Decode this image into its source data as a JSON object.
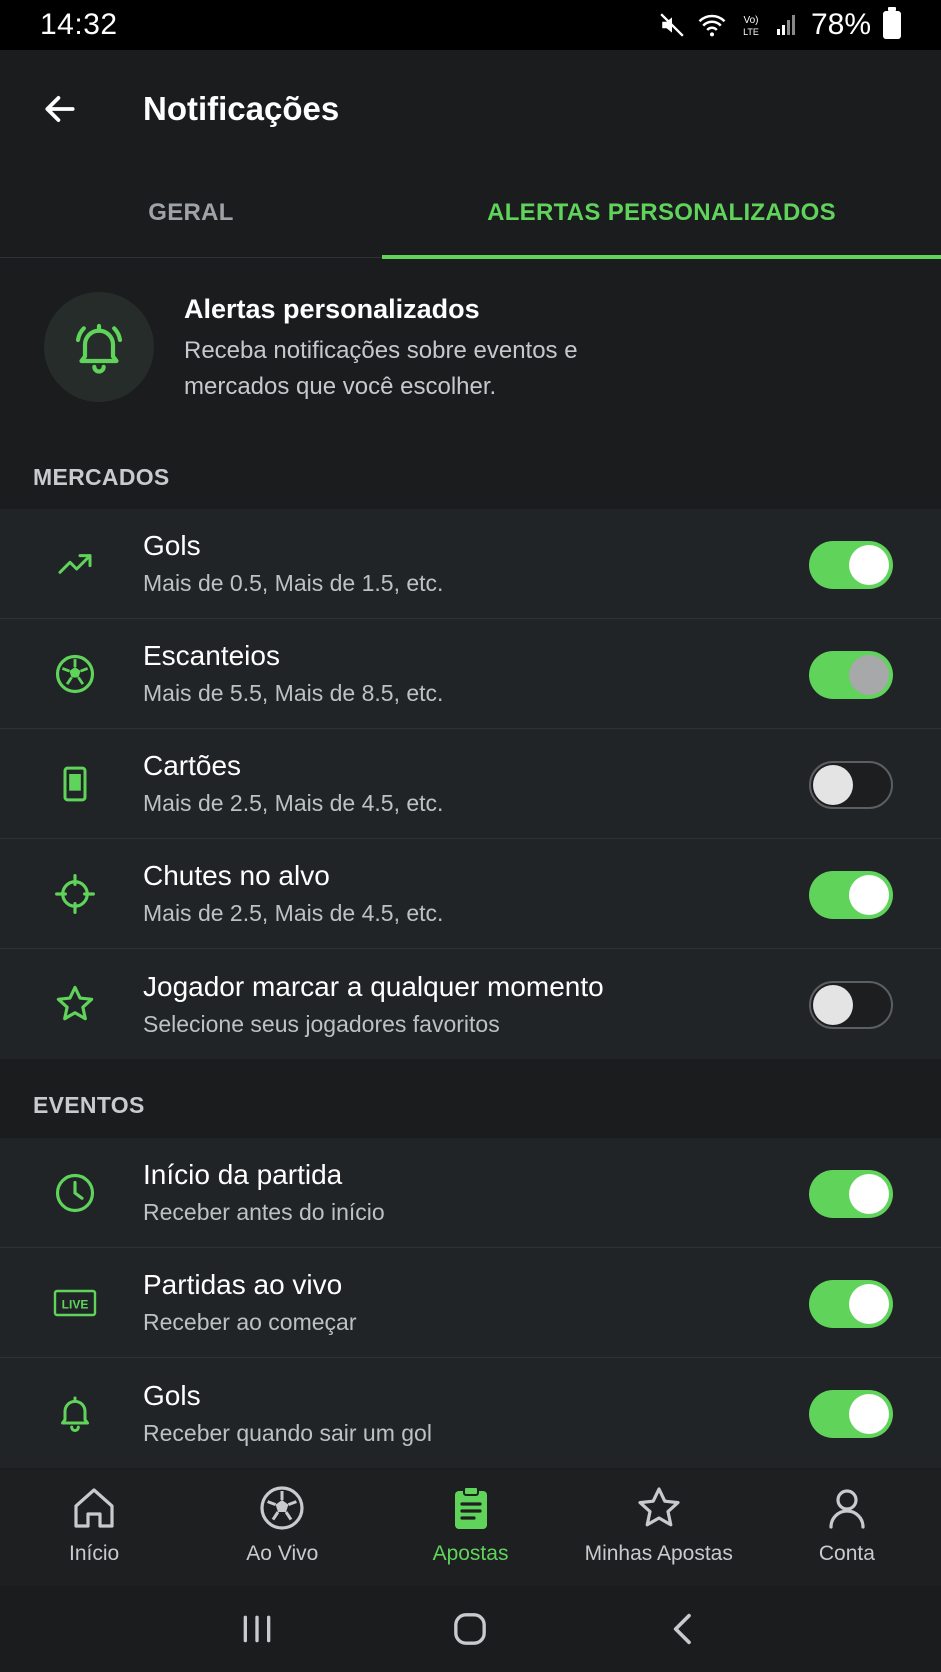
{
  "status_bar": {
    "time": "14:32",
    "battery": "78%"
  },
  "header": {
    "title": "Notificações",
    "back_icon": "arrow-left-icon"
  },
  "tabs": [
    {
      "label": "GERAL",
      "active": false
    },
    {
      "label": "ALERTAS PERSONALIZADOS",
      "active": true
    }
  ],
  "intro": {
    "icon": "bell-ringing-icon",
    "title": "Alertas personalizados",
    "description": "Receba notificações sobre eventos e mercados que você escolher."
  },
  "mercados": {
    "section_title": "MERCADOS",
    "items": [
      {
        "icon": "trend-up-icon",
        "title": "Gols",
        "subtitle": "Mais de 0.5, Mais de 1.5, etc.",
        "enabled": true
      },
      {
        "icon": "soccer-ball-icon",
        "title": "Escanteios",
        "subtitle": "Mais de 5.5, Mais de 8.5, etc.",
        "enabled": true
      },
      {
        "icon": "card-icon",
        "title": "Cartões",
        "subtitle": "Mais de 2.5, Mais de 4.5, etc.",
        "enabled": false
      },
      {
        "icon": "crosshair-icon",
        "title": "Chutes no alvo",
        "subtitle": "Mais de 2.5, Mais de 4.5, etc.",
        "enabled": true
      },
      {
        "icon": "star-icon",
        "title": "Jogador marcar a qualquer momento",
        "subtitle": "Selecione seus jogadores favoritos",
        "enabled": false
      }
    ]
  },
  "eventos": {
    "section_title": "EVENTOS",
    "items": [
      {
        "icon": "clock-icon",
        "title": "Início da partida",
        "subtitle": "Receber antes do início",
        "enabled": true
      },
      {
        "icon": "live-badge-icon",
        "title": "Partidas ao vivo",
        "subtitle": "Receber ao começar",
        "enabled": true,
        "icon_text": "LIVE"
      },
      {
        "icon": "bell-icon",
        "title": "Gols",
        "subtitle": "Receber quando sair um gol",
        "enabled": true
      }
    ]
  },
  "bottom_nav": [
    {
      "icon": "home-icon",
      "label": "Início",
      "active": false
    },
    {
      "icon": "soccer-ball-icon",
      "label": "Ao Vivo",
      "active": false
    },
    {
      "icon": "clipboard-icon",
      "label": "Apostas",
      "active": true
    },
    {
      "icon": "star-icon",
      "label": "Minhas Apostas",
      "active": false
    },
    {
      "icon": "user-icon",
      "label": "Conta",
      "active": false
    }
  ],
  "colors": {
    "accent": "#5fd35a",
    "background": "#1a1c1e",
    "card": "#212427",
    "text_secondary": "#bdc1c4"
  }
}
